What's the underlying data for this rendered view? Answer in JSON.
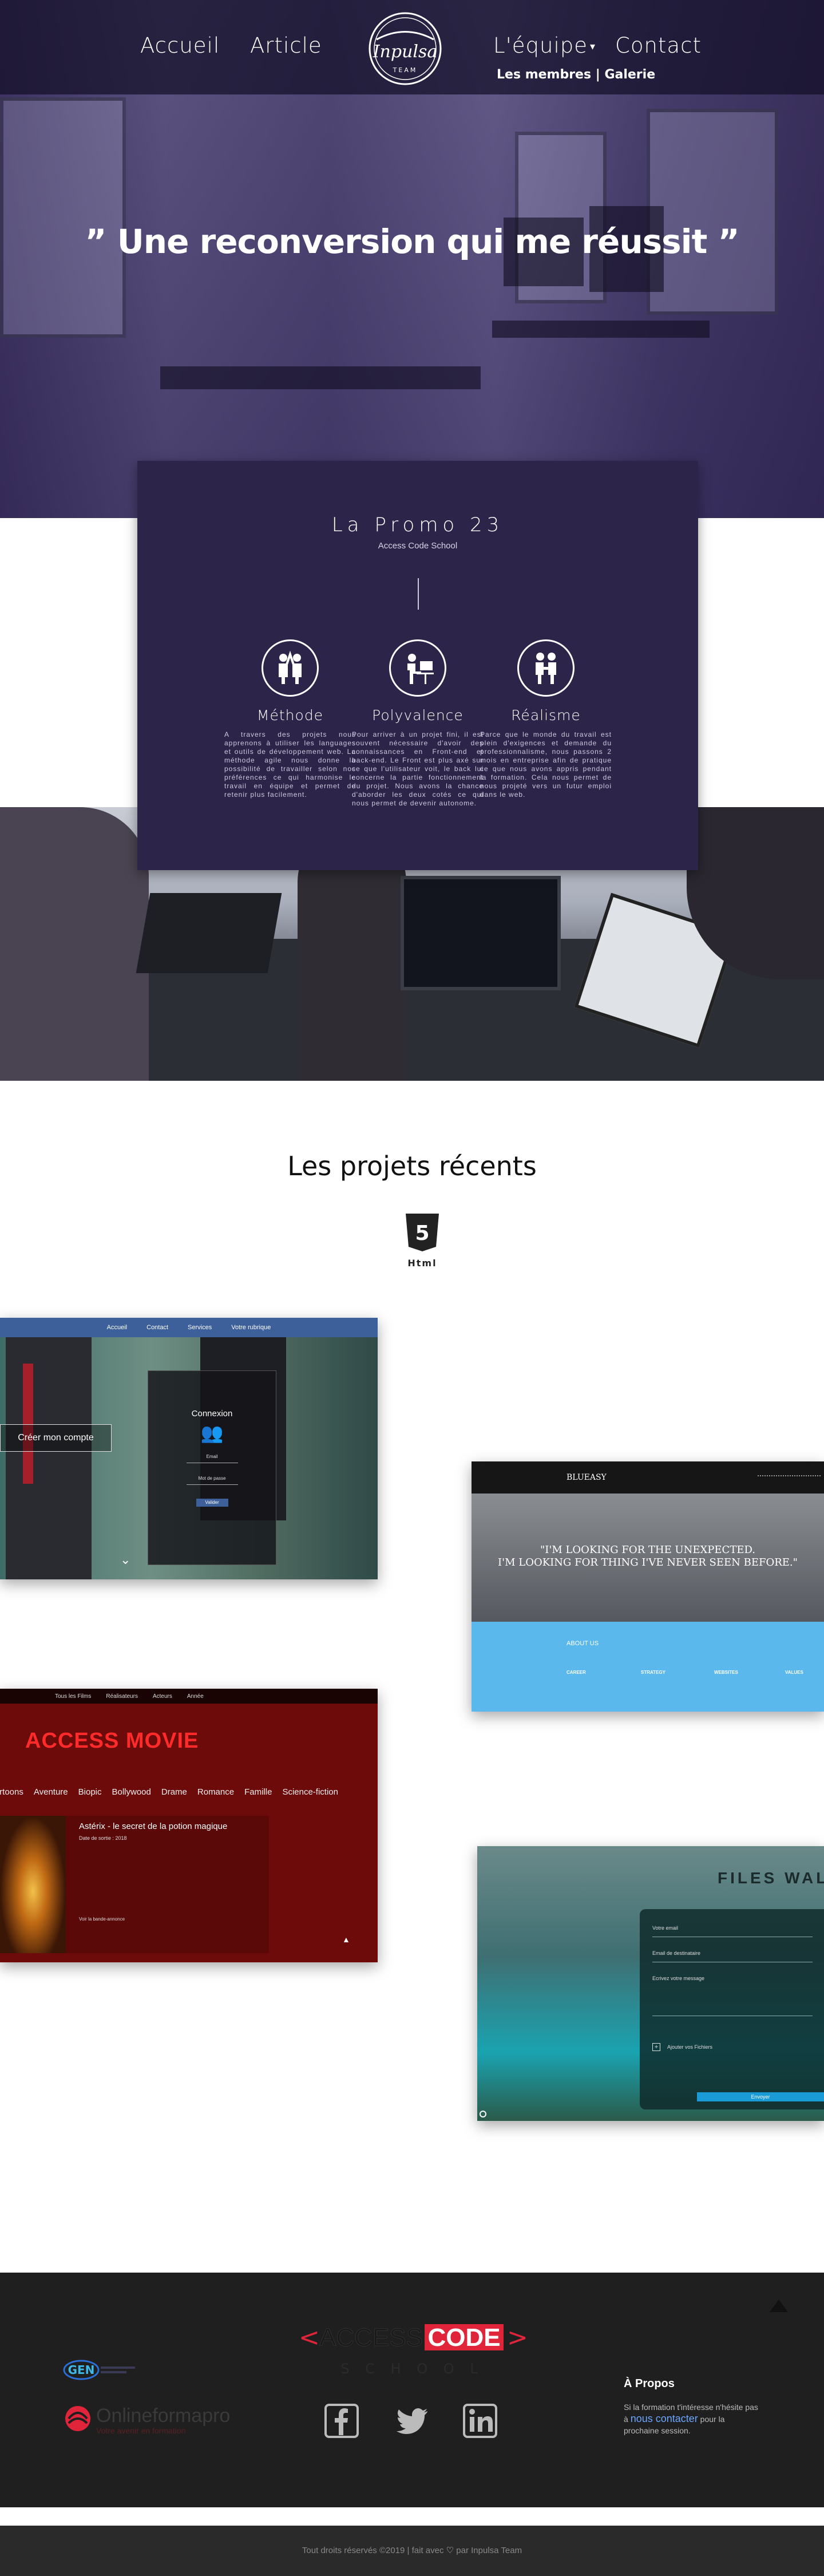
{
  "nav": {
    "accueil": "Accueil",
    "article": "Article",
    "equipe": "L'équipe",
    "contact": "Contact",
    "sub_membres": "Les membres",
    "sub_sep": " | ",
    "sub_galerie": "Galerie",
    "logo_text": "Inpulsa",
    "logo_top": "Inpulsa",
    "logo_bottom": "TEAM"
  },
  "hero": {
    "title": "” Une reconversion qui me réussit ”"
  },
  "promo": {
    "title": "La Promo 23",
    "subtitle": "Access Code School",
    "features": [
      {
        "title": "Méthode",
        "text": "A travers des projets nous apprenons à utiliser les languages et outils de développement web. La méthode agile nous donne la possibilité de travailler selon nos préférences ce qui harmonise le travail en équipe et permet de retenir plus facilement."
      },
      {
        "title": "Polyvalence",
        "text": "Pour arriver à un projet fini, il est souvent nécessaire d'avoir des connaissances en Front-end et back-end. Le Front est plus axé sur ce que l'utilisateur voit, le back lui concerne la partie fonctionnement du projet. Nous avons la chance d'aborder les deux cotés ce qui nous permet de devenir autonome."
      },
      {
        "title": "Réalisme",
        "text": "Parce que le monde du travail est plein d'exigences et demande du professionnalisme, nous passons 2 mois en entreprise afin de pratique ce que nous avons appris pendant la formation. Cela nous permet de nous projeté vers un futur emploi dans le web."
      }
    ]
  },
  "projects": {
    "title": "Les projets récents",
    "html5_label": "Html",
    "html5_number": "5",
    "shot1": {
      "nav": [
        "Accueil",
        "Contact",
        "Services",
        "Votre rubrique"
      ],
      "create_button": "Créer mon compte",
      "login_title": "Connexion",
      "email_label": "Email",
      "password_label": "Mot de passe",
      "submit": "Valider"
    },
    "shot2": {
      "brand": "BLUEASY",
      "quote_line1": "\"I'M LOOKING FOR THE UNEXPECTED.",
      "quote_line2": "I'M LOOKING FOR THING I'VE NEVER SEEN BEFORE.\"",
      "section_title": "ABOUT US",
      "cols": [
        "CAREER",
        "STRATEGY",
        "WEBSITES",
        "VALUES"
      ]
    },
    "shot3": {
      "nav": [
        "Tous les Films",
        "Réalisateurs",
        "Acteurs",
        "Année"
      ],
      "logo": "ACCESS MOVIE",
      "genres": [
        "Cartoons",
        "Aventure",
        "Biopic",
        "Bollywood",
        "Drame",
        "Romance",
        "Famille",
        "Science-fiction"
      ],
      "movie_title": "Astérix - le secret de la potion magique",
      "movie_meta": "Date de sortie : 2018",
      "read_more": "Voir la bande-annonce"
    },
    "shot4": {
      "title": "FILES WALK",
      "fields": [
        "Votre email",
        "Email de destinataire",
        "Ecrivez votre message"
      ],
      "add_files": "Ajouter vos Fichiers",
      "send": "Envoyer"
    }
  },
  "footer": {
    "brand_left": "ACCESS",
    "brand_right": "CODE",
    "brand_school": "S C H O O L",
    "partner1": "GEN",
    "partner2": "Onlineformapro",
    "partner2_sub": "Votre avenir en formation",
    "about_title": "À Propos",
    "about_text_1": "Si la formation t'intéresse n'hésite pas à ",
    "about_link": "nous contacter",
    "about_text_2": " pour la prochaine session.",
    "copyright_1": "Tout droits réservés ©2019 | fait avec ",
    "copyright_2": " par Inpulsa Team"
  },
  "colors": {
    "promo_bg": "#2d2449",
    "footer_bg": "#1f1f1f",
    "accent_red": "#e0243a",
    "link_blue": "#6aa6ff"
  }
}
